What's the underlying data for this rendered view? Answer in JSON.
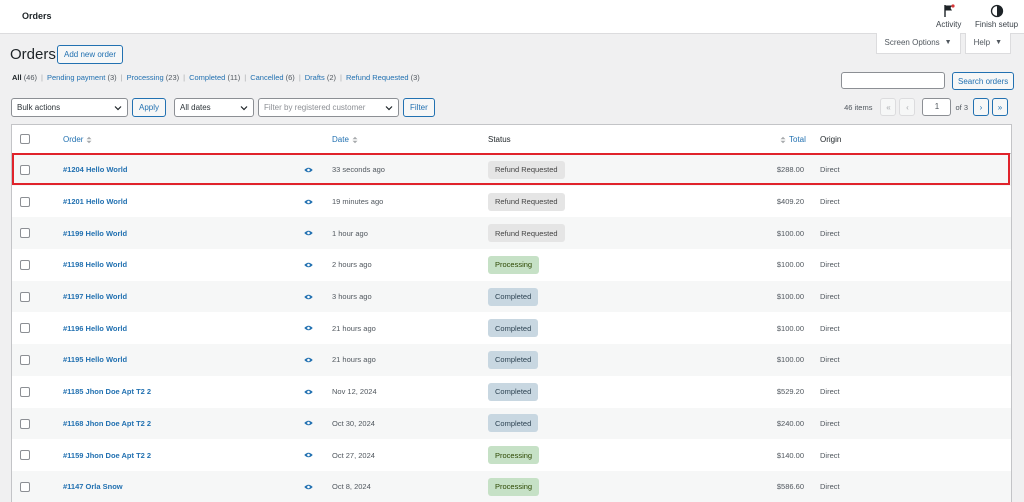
{
  "topbar": {
    "title": "Orders",
    "activity": "Activity",
    "finish_setup": "Finish setup"
  },
  "screen_options": "Screen Options",
  "help": "Help",
  "page": {
    "title": "Orders",
    "add_new": "Add new order"
  },
  "filters": [
    {
      "label": "All",
      "count": "(46)",
      "current": true
    },
    {
      "label": "Pending payment",
      "count": "(3)"
    },
    {
      "label": "Processing",
      "count": "(23)"
    },
    {
      "label": "Completed",
      "count": "(11)"
    },
    {
      "label": "Cancelled",
      "count": "(6)"
    },
    {
      "label": "Drafts",
      "count": "(2)"
    },
    {
      "label": "Refund Requested",
      "count": "(3)"
    }
  ],
  "search": {
    "button": "Search orders",
    "value": ""
  },
  "tablenav": {
    "bulk_actions": "Bulk actions",
    "apply": "Apply",
    "all_dates": "All dates",
    "customer_placeholder": "Filter by registered customer",
    "filter": "Filter",
    "items": "46 items",
    "first": "«",
    "prev": "‹",
    "current_page": "1",
    "of": "of 3",
    "next": "›",
    "last": "»"
  },
  "columns": {
    "order": "Order",
    "date": "Date",
    "status": "Status",
    "total": "Total",
    "origin": "Origin"
  },
  "colors": {
    "highlight": "#e0232b",
    "link": "#2271b1"
  },
  "rows": [
    {
      "order": "#1204 Hello World",
      "date": "33 seconds ago",
      "status": "Refund Requested",
      "status_type": "refund",
      "total": "$288.00",
      "origin": "Direct"
    },
    {
      "order": "#1201 Hello World",
      "date": "19 minutes ago",
      "status": "Refund Requested",
      "status_type": "refund",
      "total": "$409.20",
      "origin": "Direct"
    },
    {
      "order": "#1199 Hello World",
      "date": "1 hour ago",
      "status": "Refund Requested",
      "status_type": "refund",
      "total": "$100.00",
      "origin": "Direct"
    },
    {
      "order": "#1198 Hello World",
      "date": "2 hours ago",
      "status": "Processing",
      "status_type": "processing",
      "total": "$100.00",
      "origin": "Direct"
    },
    {
      "order": "#1197 Hello World",
      "date": "3 hours ago",
      "status": "Completed",
      "status_type": "completed",
      "total": "$100.00",
      "origin": "Direct"
    },
    {
      "order": "#1196 Hello World",
      "date": "21 hours ago",
      "status": "Completed",
      "status_type": "completed",
      "total": "$100.00",
      "origin": "Direct"
    },
    {
      "order": "#1195 Hello World",
      "date": "21 hours ago",
      "status": "Completed",
      "status_type": "completed",
      "total": "$100.00",
      "origin": "Direct"
    },
    {
      "order": "#1185 Jhon Doe Apt T2 2",
      "date": "Nov 12, 2024",
      "status": "Completed",
      "status_type": "completed",
      "total": "$529.20",
      "origin": "Direct"
    },
    {
      "order": "#1168 Jhon Doe Apt T2 2",
      "date": "Oct 30, 2024",
      "status": "Completed",
      "status_type": "completed",
      "total": "$240.00",
      "origin": "Direct"
    },
    {
      "order": "#1159 Jhon Doe Apt T2 2",
      "date": "Oct 27, 2024",
      "status": "Processing",
      "status_type": "processing",
      "total": "$140.00",
      "origin": "Direct"
    },
    {
      "order": "#1147 Orla Snow",
      "date": "Oct 8, 2024",
      "status": "Processing",
      "status_type": "processing",
      "total": "$586.60",
      "origin": "Direct"
    }
  ]
}
